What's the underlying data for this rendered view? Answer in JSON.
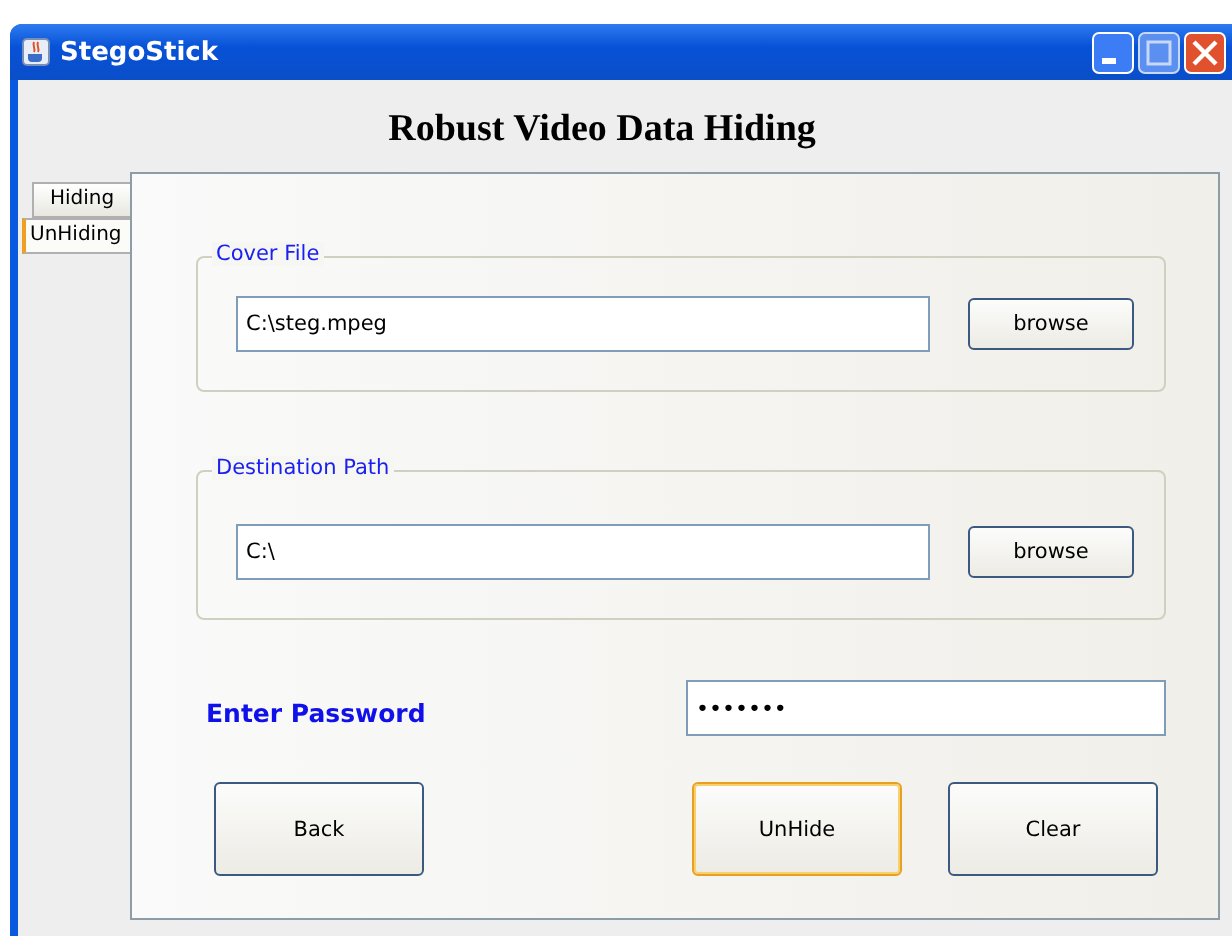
{
  "window": {
    "title": "StegoStick"
  },
  "heading": "Robust Video Data Hiding",
  "tabs": [
    {
      "label": "Hiding",
      "selected": false
    },
    {
      "label": "UnHiding",
      "selected": true
    }
  ],
  "groups": [
    {
      "title": "Cover File",
      "value": "C:\\steg.mpeg",
      "button": "browse"
    },
    {
      "title": "Destination Path",
      "value": "C:\\",
      "button": "browse"
    }
  ],
  "password": {
    "label": "Enter Password",
    "value": "•••••••"
  },
  "buttons": [
    {
      "label": "Back",
      "focused": false
    },
    {
      "label": "UnHide",
      "focused": true
    },
    {
      "label": "Clear",
      "focused": false
    }
  ]
}
